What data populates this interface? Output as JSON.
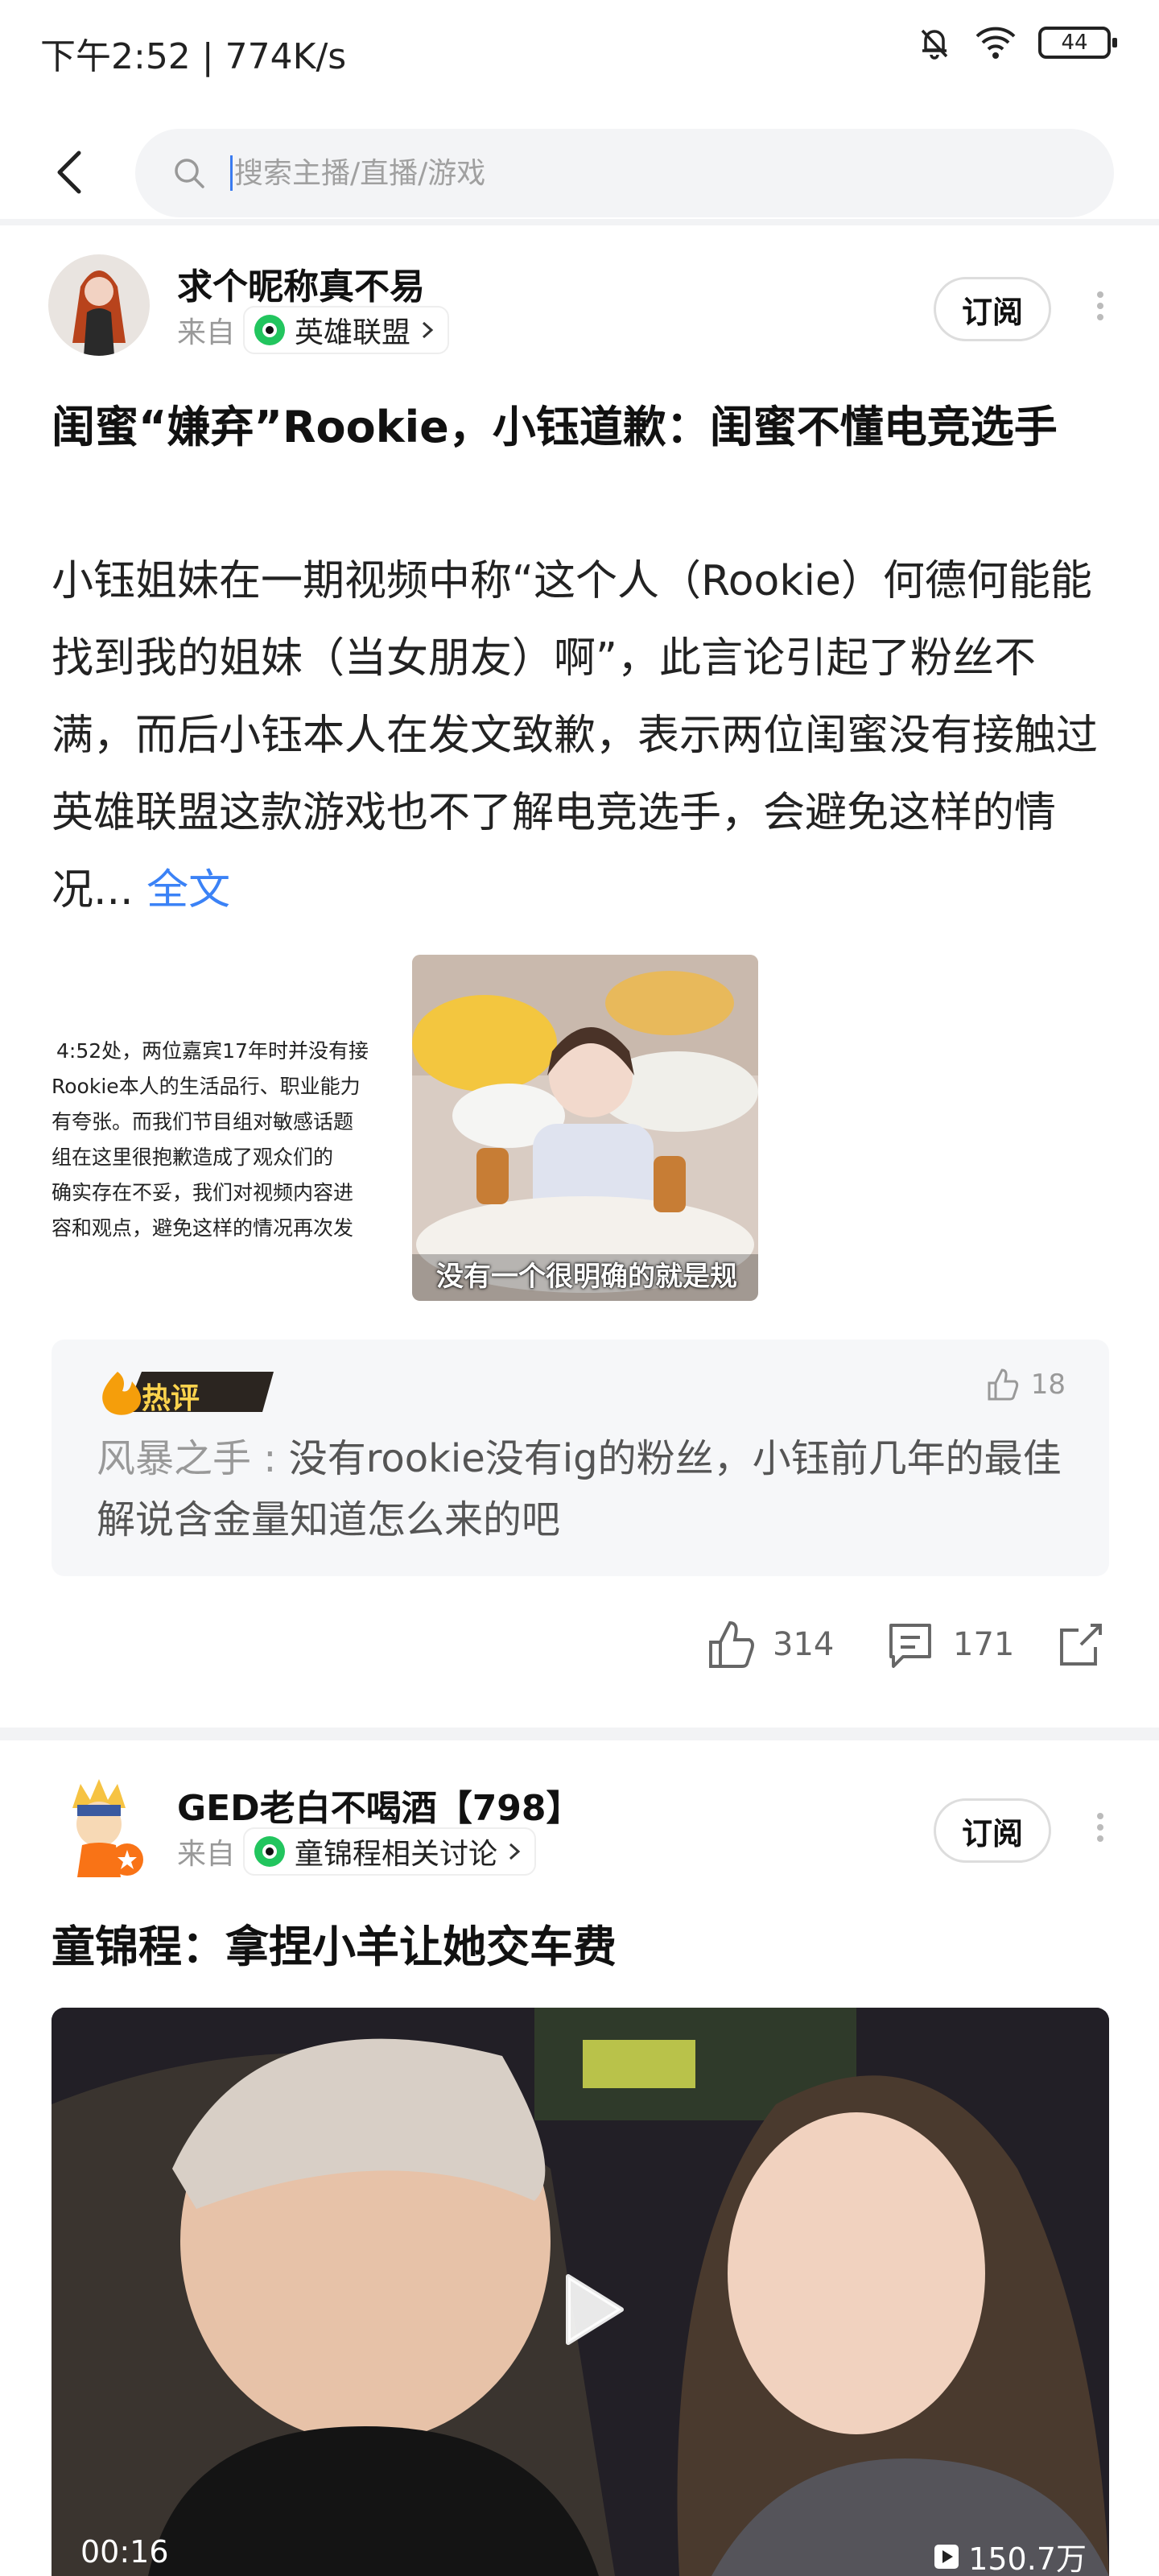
{
  "status_bar": {
    "time": "下午2:52 | 774K/s",
    "battery": "44"
  },
  "search": {
    "placeholder": "搜索主播/直播/游戏"
  },
  "posts": [
    {
      "author": "求个昵称真不易",
      "from_label": "来自",
      "topic": "英雄联盟",
      "subscribe_label": "订阅",
      "title": "闺蜜“嫌弃”Rookie，小钰道歉：闺蜜不懂电竞选手",
      "body": "小钰姐妹在一期视频中称“这个人（Rookie）何德何能能找到我的姐妹（当女朋友）啊”，此言论引起了粉丝不满，而后小钰本人在发文致歉，表示两位闺蜜没有接触过英雄联盟这款游戏也不了解电竞选手，会避免这样的情况...",
      "full_text_link": "全文",
      "image_left_lines": [
        "4:52处，两位嘉宾17年时并没有接",
        "Rookie本人的生活品行、职业能力",
        "有夸张。而我们节目组对敏感话题",
        "组在这里很抱歉造成了观众们的",
        "确实存在不妥，我们对视频内容进",
        "容和观点，避免这样的情况再次发"
      ],
      "image_right_caption": "没有一个很明确的就是规",
      "hot_comment": {
        "badge": "热评",
        "likes": "18",
        "user": "风暴之手 : ",
        "text": "没有rookie没有ig的粉丝，小钰前几年的最佳解说含金量知道怎么来的吧"
      },
      "actions": {
        "likes": "314",
        "comments": "171"
      }
    },
    {
      "author": "GED老白不喝酒【798】",
      "from_label": "来自",
      "topic": "童锦程相关讨论",
      "subscribe_label": "订阅",
      "title": "童锦程：拿捏小羊让她交车费",
      "video": {
        "duration": "00:16",
        "views": "150.7万"
      }
    }
  ],
  "colors": {
    "accent_blue": "#3b82f6",
    "topic_green": "#22c55e",
    "hot_orange": "#f59e0b"
  }
}
